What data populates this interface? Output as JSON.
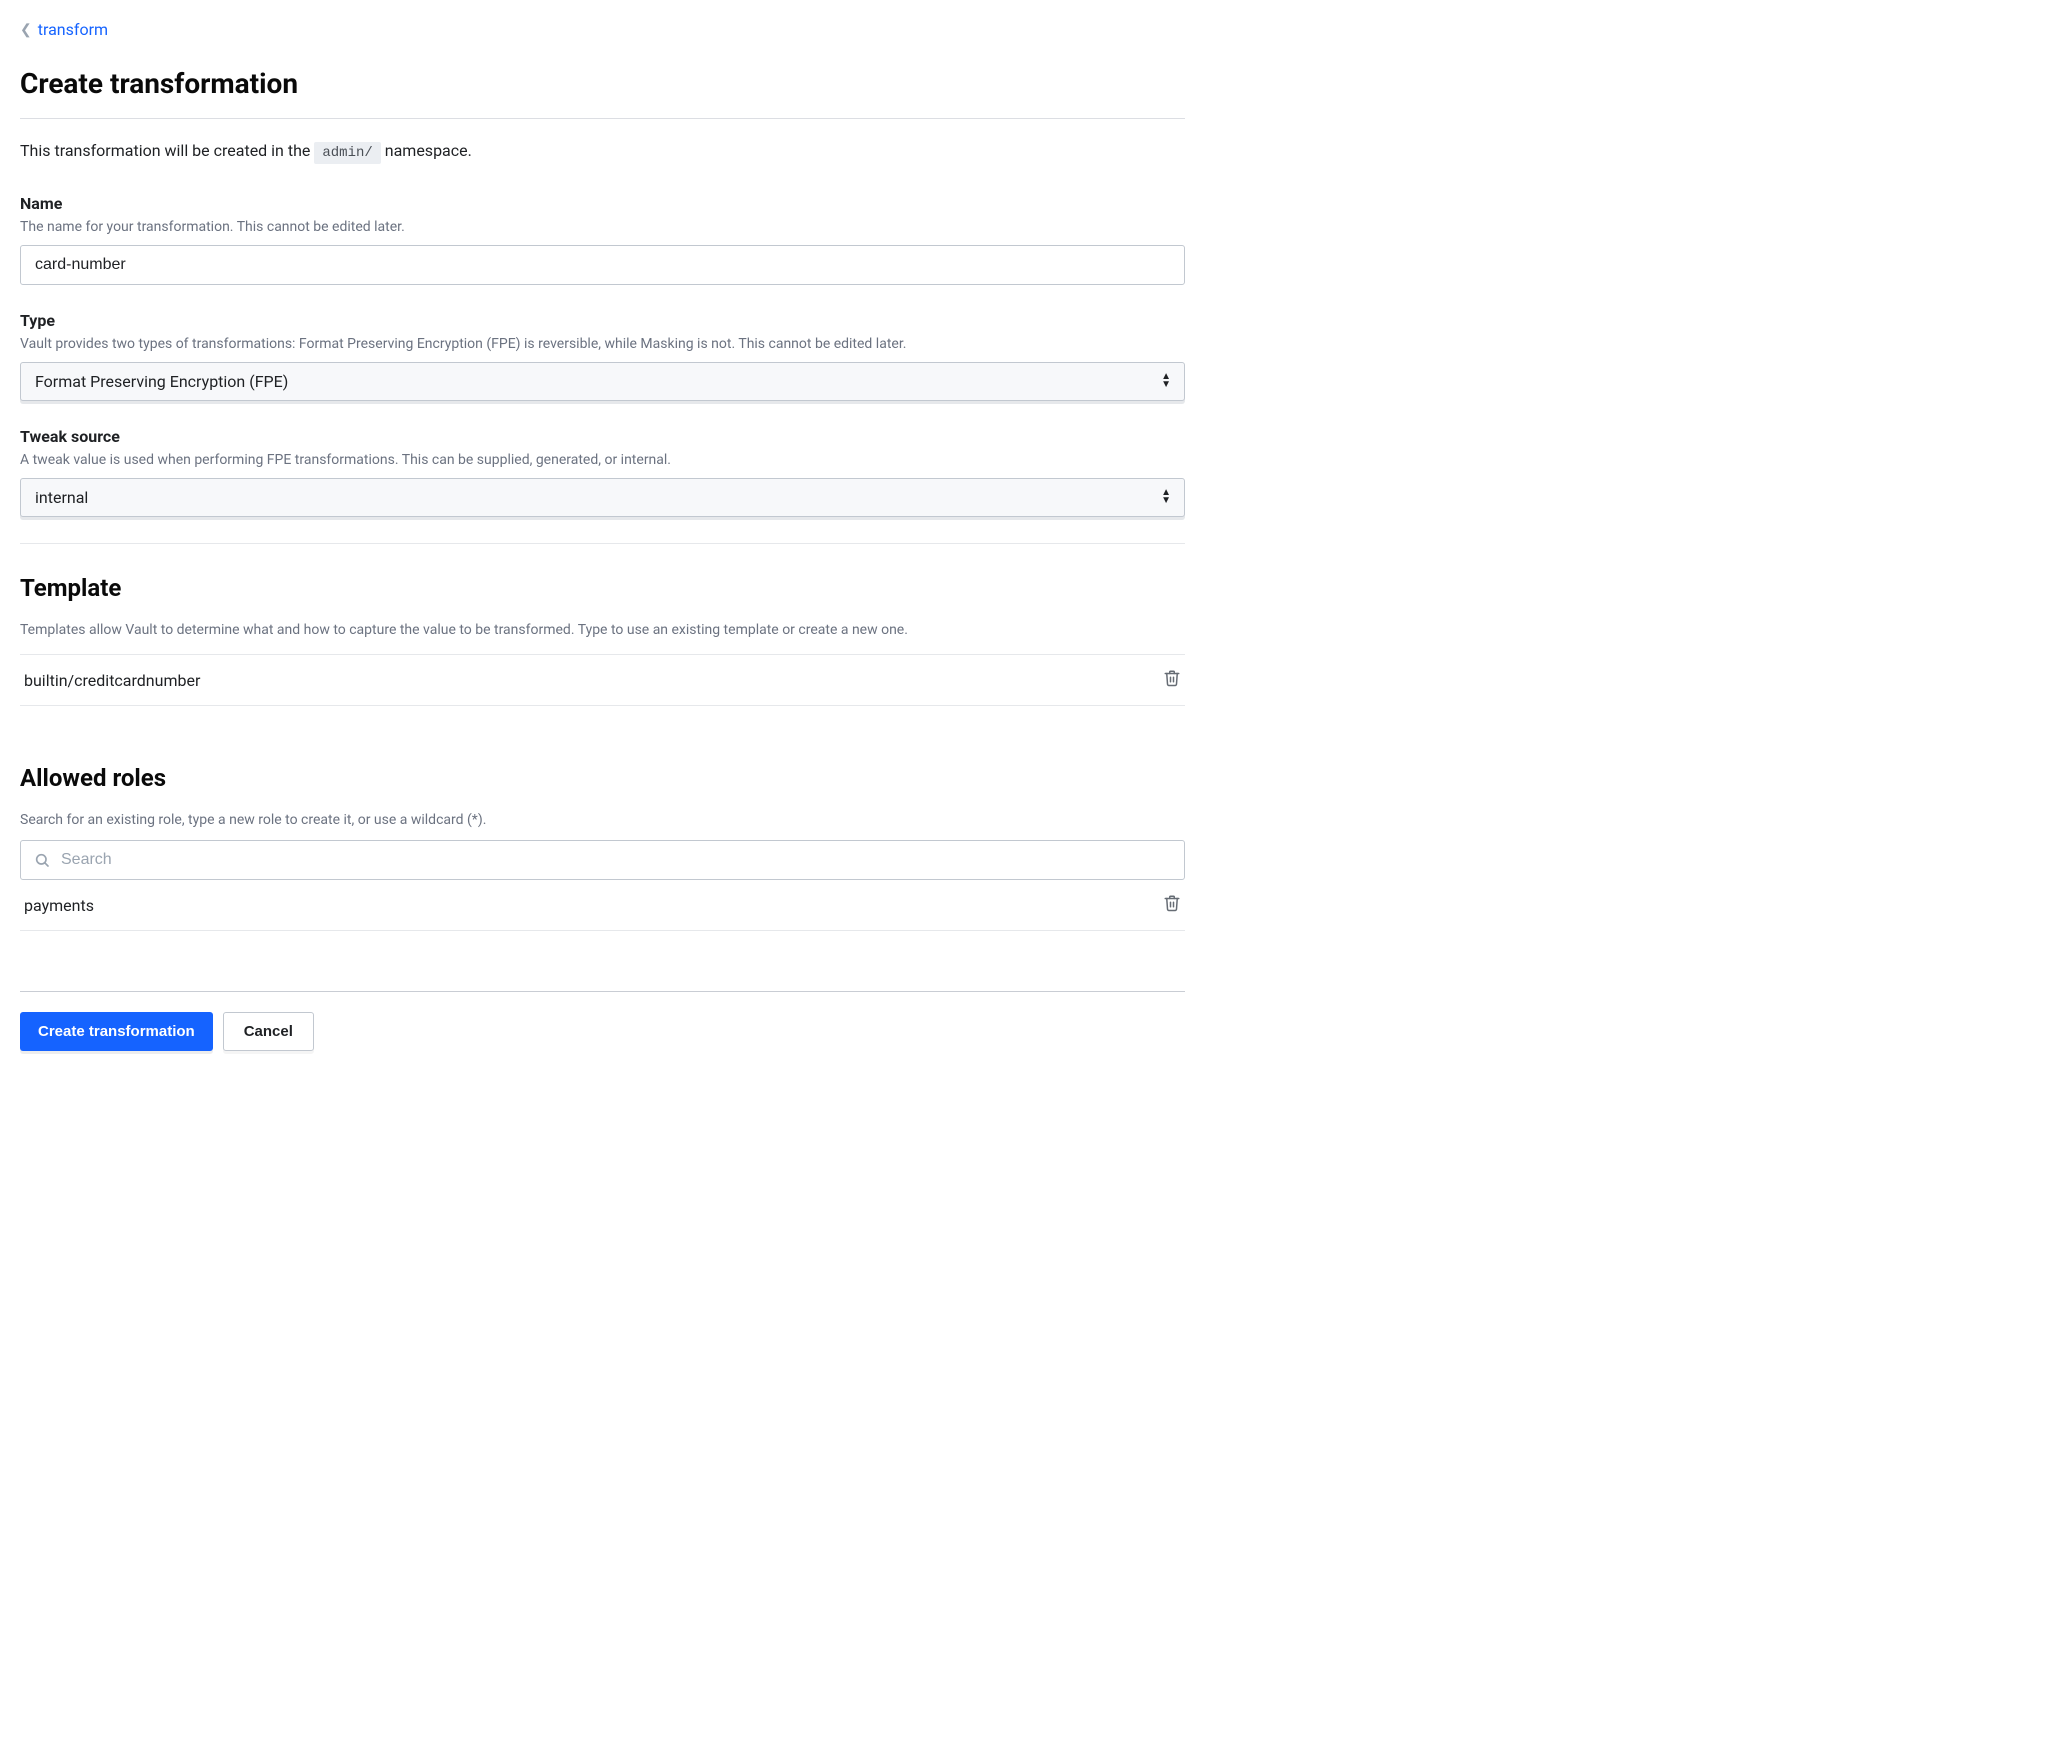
{
  "breadcrumb": {
    "parent_label": "transform"
  },
  "page": {
    "title": "Create transformation",
    "namespace_prefix": "This transformation will be created in the ",
    "namespace_code": "admin/",
    "namespace_suffix": " namespace."
  },
  "fields": {
    "name": {
      "label": "Name",
      "help": "The name for your transformation. This cannot be edited later.",
      "value": "card-number"
    },
    "type": {
      "label": "Type",
      "help": "Vault provides two types of transformations: Format Preserving Encryption (FPE) is reversible, while Masking is not. This cannot be edited later.",
      "value": "Format Preserving Encryption (FPE)"
    },
    "tweak_source": {
      "label": "Tweak source",
      "help": "A tweak value is used when performing FPE transformations. This can be supplied, generated, or internal.",
      "value": "internal"
    }
  },
  "template": {
    "title": "Template",
    "help": "Templates allow Vault to determine what and how to capture the value to be transformed. Type to use an existing template or create a new one.",
    "items": [
      {
        "name": "builtin/creditcardnumber"
      }
    ]
  },
  "roles": {
    "title": "Allowed roles",
    "help": "Search for an existing role, type a new role to create it, or use a wildcard (*).",
    "search_placeholder": "Search",
    "items": [
      {
        "name": "payments"
      }
    ]
  },
  "actions": {
    "submit_label": "Create transformation",
    "cancel_label": "Cancel"
  }
}
